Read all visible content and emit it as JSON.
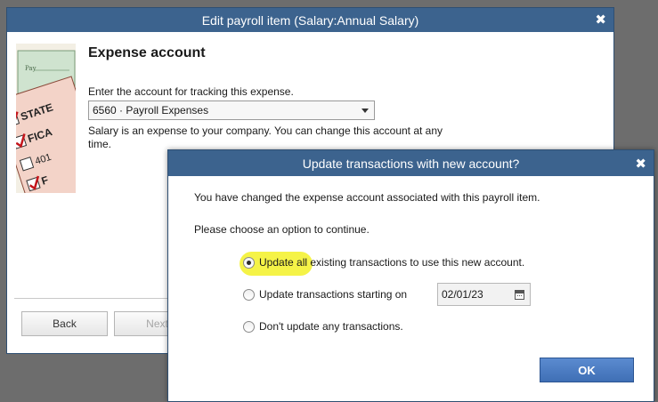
{
  "parent_window": {
    "title": "Edit payroll item (Salary:Annual Salary)",
    "close_glyph": "✖",
    "heading": "Expense account",
    "prompt": "Enter the account for tracking this expense.",
    "account_select_value": "6560 · Payroll Expenses",
    "note": "Salary is an expense to your company. You can change this account at any time.",
    "back_label": "Back",
    "next_label": "Next",
    "illustration_labels": [
      "Pay",
      "STATE",
      "FICA",
      "401",
      "F"
    ]
  },
  "dialog": {
    "title": "Update transactions with new account?",
    "close_glyph": "✖",
    "message1": "You have changed the expense account associated with this payroll item.",
    "message2": "Please choose an option to continue.",
    "options": [
      {
        "label": "Update all existing transactions to use this new account.",
        "selected": true
      },
      {
        "label": "Update transactions starting on",
        "selected": false
      },
      {
        "label": "Don't update any transactions.",
        "selected": false
      }
    ],
    "start_date": "02/01/23",
    "ok_label": "OK"
  },
  "colors": {
    "titlebar": "#3c638e",
    "highlight": "#f4f23d",
    "ok_button": "#4a7cc2"
  }
}
